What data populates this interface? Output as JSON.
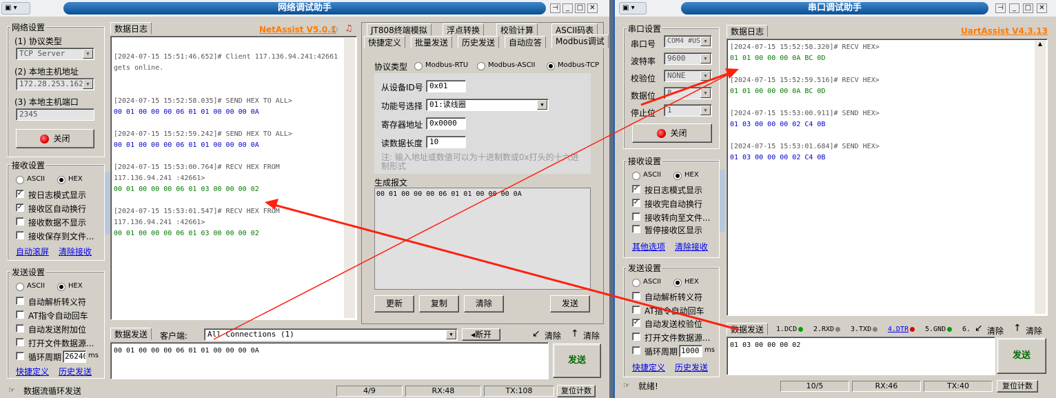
{
  "left": {
    "title": "网络调试助手",
    "brand": "NetAssist V5.0.1",
    "net_settings": {
      "title": "网络设置",
      "protocol_label": "(1) 协议类型",
      "protocol_value": "TCP Server",
      "host_label": "(2) 本地主机地址",
      "host_value": "172.28.253.162",
      "port_label": "(3) 本地主机端口",
      "port_value": "2345",
      "close_button": "关闭"
    },
    "recv_settings": {
      "title": "接收设置",
      "ascii": "ASCII",
      "hex": "HEX",
      "opt1": "按日志模式显示",
      "opt2": "接收区自动换行",
      "opt3": "接收数据不显示",
      "opt4": "接收保存到文件...",
      "link1": "自动滚屏",
      "link2": "清除接收"
    },
    "send_settings": {
      "title": "发送设置",
      "ascii": "ASCII",
      "hex": "HEX",
      "opt1": "自动解析转义符",
      "opt2": "AT指令自动回车",
      "opt3": "自动发送附加位",
      "opt4": "打开文件数据源...",
      "opt5": "循环周期",
      "period": "26240",
      "unit": "ms",
      "link1": "快捷定义",
      "link2": "历史发送"
    },
    "log_tab": "数据日志",
    "log": [
      {
        "head": "[2024-07-15 15:51:46.652]# Client 117.136.94.241:42661",
        "tail": "gets online.",
        "data": ""
      },
      {
        "head": "[2024-07-15 15:52:58.035]# SEND HEX TO ALL>",
        "tail": "",
        "data": "00 01 00 00 00 06 01 01 00 00 00 0A"
      },
      {
        "head": "[2024-07-15 15:52:59.242]# SEND HEX TO ALL>",
        "tail": "",
        "data": "00 01 00 00 00 06 01 01 00 00 00 0A"
      },
      {
        "head": "[2024-07-15 15:53:00.764]# RECV HEX FROM",
        "tail": "117.136.94.241 :42661>",
        "data": "00 01 00 00 00 06 01 03 00 00 00 02"
      },
      {
        "head": "[2024-07-15 15:53:01.547]# RECV HEX FROM",
        "tail": "117.136.94.241 :42661>",
        "data": "00 01 00 00 00 06 01 03 00 00 00 02"
      }
    ],
    "tabs_row1": [
      "JT808终端模拟",
      "浮点转换",
      "校验计算",
      "ASCII码表"
    ],
    "tabs_row2": [
      "快捷定义",
      "批量发送",
      "历史发送",
      "自动应答",
      "Modbus调试"
    ],
    "modbus": {
      "protocol_label": "协议类型",
      "rtu": "Modbus-RTU",
      "ascii": "Modbus-ASCII",
      "tcp": "Modbus-TCP",
      "slave_label": "从设备ID号",
      "slave_value": "0x01",
      "func_label": "功能号选择",
      "func_value": "01:读线圈",
      "reg_label": "寄存器地址",
      "reg_value": "0x0000",
      "len_label": "读数据长度",
      "len_value": "10",
      "note": "注: 输入地址或数值可以为十进制数或0x打头的十六进制形式",
      "gen_label": "生成报文",
      "gen_value": "00 01 00 00 00 06 01 01 00 00 00 0A",
      "btn_update": "更新",
      "btn_copy": "复制",
      "btn_clear": "清除",
      "btn_send": "发送"
    },
    "send_tab": "数据发送",
    "client_label": "客户端:",
    "client_value": "All Connections (1)",
    "disconnect": "断开",
    "clear1": "清除",
    "clear2": "清除",
    "send_data": "00 01 00 00 00 06 01 01 00 00 00 0A",
    "send_button": "发送",
    "status": {
      "text": "数据流循环发送",
      "count": "4/9",
      "rx": "RX:48",
      "tx": "TX:108",
      "reset": "复位计数"
    }
  },
  "right": {
    "title": "串口调试助手",
    "brand": "UartAssist V4.3.13",
    "port_settings": {
      "title": "串口设置",
      "port_label": "串口号",
      "port_value": "COM4 #USI",
      "baud_label": "波特率",
      "baud_value": "9600",
      "parity_label": "校验位",
      "parity_value": "NONE",
      "data_label": "数据位",
      "data_value": "8",
      "stop_label": "停止位",
      "stop_value": "1",
      "close_button": "关闭"
    },
    "recv_settings": {
      "title": "接收设置",
      "ascii": "ASCII",
      "hex": "HEX",
      "opt1": "按日志模式显示",
      "opt2": "接收完自动换行",
      "opt3": "接收转向至文件...",
      "opt4": "暂停接收区显示",
      "link1": "其他选项",
      "link2": "清除接收"
    },
    "send_settings": {
      "title": "发送设置",
      "ascii": "ASCII",
      "hex": "HEX",
      "opt1": "自动解析转义符",
      "opt2": "AT指令自动回车",
      "opt3": "自动发送校验位",
      "opt4": "打开文件数据源...",
      "opt5": "循环周期",
      "period": "1000",
      "unit": "ms",
      "link1": "快捷定义",
      "link2": "历史发送"
    },
    "log_tab": "数据日志",
    "log": [
      {
        "head": "[2024-07-15 15:52:58.320]# RECV HEX>",
        "data": "01 01 00 00 00 0A BC 0D",
        "kind": "recv"
      },
      {
        "head": "[2024-07-15 15:52:59.516]# RECV HEX>",
        "data": "01 01 00 00 00 0A BC 0D",
        "kind": "recv"
      },
      {
        "head": "[2024-07-15 15:53:00.911]# SEND HEX>",
        "data": "01 03 00 00 00 02 C4 0B",
        "kind": "send"
      },
      {
        "head": "[2024-07-15 15:53:01.684]# SEND HEX>",
        "data": "01 03 00 00 00 02 C4 0B",
        "kind": "send"
      }
    ],
    "send_tab": "数据发送",
    "signals": [
      "1.DCD",
      "2.RXD",
      "3.TXD",
      "4.DTR",
      "5.GND",
      "6."
    ],
    "signal_colors": [
      "#00a000",
      "#808080",
      "#808080",
      "#e00000",
      "#00a000"
    ],
    "clear1": "清除",
    "clear2": "清除",
    "send_data": "01 03 00 00 00 02",
    "send_button": "发送",
    "status": {
      "text": "就绪!",
      "count": "10/5",
      "rx": "RX:46",
      "tx": "TX:40",
      "reset": "复位计数"
    }
  }
}
